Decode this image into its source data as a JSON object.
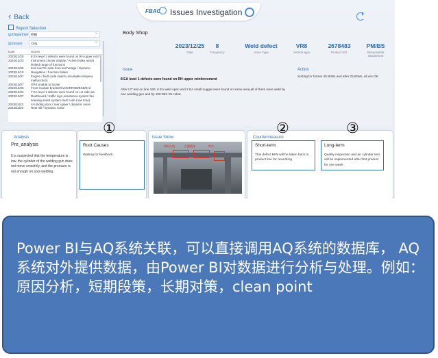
{
  "header": {
    "logo_text": "FBAC",
    "title": "Issues Investigation"
  },
  "nav": {
    "back_label": "Back",
    "report_selection": "Report Selection"
  },
  "filters": [
    {
      "label": "Department",
      "value": "机械"
    },
    {
      "label": "Issues",
      "value": "Cklg"
    }
  ],
  "issue_list": {
    "col_date": "Date",
    "col_issues": "Issues",
    "rows": [
      {
        "date": "2023/12/25",
        "text": "8 EA level 1 defects were found on RH upper reinf"
      },
      {
        "date": "2023/12/23",
        "text": "Instrument cluster display / Active brake assist"
      },
      {
        "date": "",
        "text": "limited range of functions"
      },
      {
        "date": "2023/12/25",
        "text": "2nd row RH seat from anchorage / dynamic"
      },
      {
        "date": "2023/12/10",
        "text": "Navigation / function failure"
      },
      {
        "date": "2023/12/07",
        "text": "Engine / fault code switch unsuitable tempera"
      },
      {
        "date": "",
        "text": "malfunction)"
      },
      {
        "date": "2023/12/07",
        "text": "GPS unable to locate"
      },
      {
        "date": "2023/12/06",
        "text": "Front module bracket/rivets/RRXB/BXB/B sl"
      },
      {
        "date": "2023/12/04",
        "text": "7 EA level 1 defects were found on LH side wa"
      },
      {
        "date": "2023/12/07",
        "text": "Dashboard / traffic sign assistance system fau"
      },
      {
        "date": "",
        "text": "keeping assist system fault code (one time)"
      },
      {
        "date": "2023/11/22",
        "text": "LH sliding door / rear upper / dynamic noise"
      },
      {
        "date": "2023/11/20",
        "text": "Rear sill / dynamic noise"
      }
    ]
  },
  "detail": {
    "department": "Body Shop",
    "date": {
      "value": "2023/12/25",
      "label": "Date"
    },
    "frequency": {
      "value": "8",
      "label": "Frequency"
    },
    "issue_type": {
      "value": "Weld defect",
      "label": "Issue Type"
    },
    "vehicle_type": {
      "value": "VR8",
      "label": "Vehicle type"
    },
    "product_no": {
      "value": "2678483",
      "label": "Product NO."
    },
    "responsible": {
      "value": "PM/BS",
      "label": "Responsible department"
    },
    "issue_label": "Issue",
    "issue_title": "8 EA level 1 defects were found on RH upper reinforcement",
    "issue_body": "After UT test on line 160, 6 EA weld open and 2 EA small nugget were found on same area,all of them were weld by one welding gun and by 160.09S R1 robot.",
    "action_label": "Action",
    "action_body": "Sorting for former 25 BIWs and after 25 BIWs, all are OK"
  },
  "bottom": {
    "analysis_label": "Analysis",
    "pre_analysis_title": "Pre_analysis",
    "pre_analysis_text": "It is suspected that the temperature is low, the cylinder of the welding gun does not move smoothly, and the pressure is not enough on spot welding",
    "root_causes_title": "Root Causes",
    "root_causes_text": "Waiting for feedback",
    "issue_show_label": "Issue Show",
    "photo_tags": [
      "焊枪左侧",
      "打磨痕迹",
      "焊点"
    ],
    "counter_label": "Countermeasure",
    "short_term_title": "Short-term",
    "short_term_text": "This defect BIW will be taken back to product line for reworking",
    "long_term_title": "Long-term",
    "long_term_text": "Quality inspection and air cylinder test will be implemented after first product for one week"
  },
  "markers": [
    "①",
    "②",
    "③"
  ],
  "note": {
    "text": "Power BI与AQ系统关联，可以直接调用AQ系统的数据库， AQ系统对外提供数据，由Power BI对数据进行分析与处理。例如：原因分析，短期段策，长期对策，clean point"
  },
  "colors": {
    "accent": "#2d6fb8",
    "note_bg": "#4a78b8",
    "value_text": "#2e68a7"
  }
}
